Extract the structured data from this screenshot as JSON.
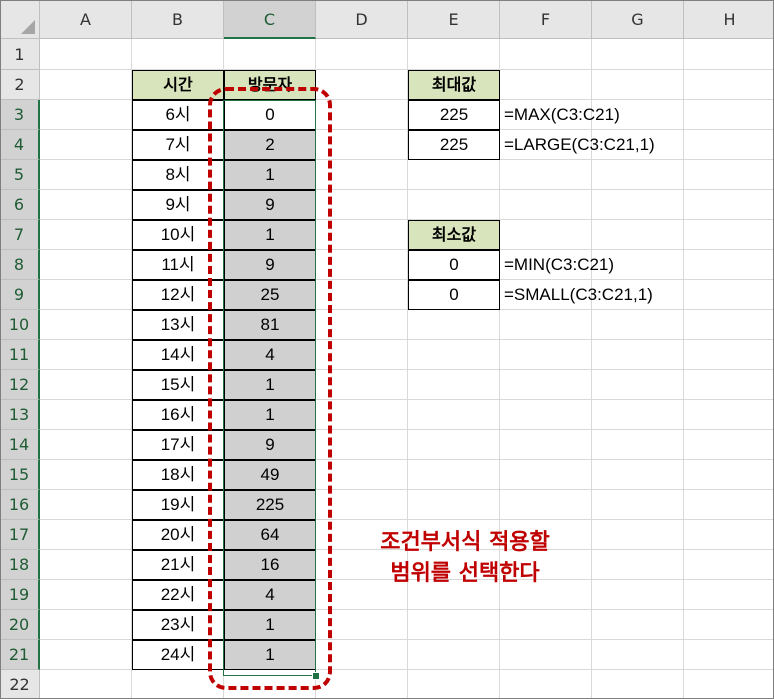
{
  "columns": [
    "A",
    "B",
    "C",
    "D",
    "E",
    "F",
    "G",
    "H"
  ],
  "selected_column": "C",
  "rows": [
    "1",
    "2",
    "3",
    "4",
    "5",
    "6",
    "7",
    "8",
    "9",
    "10",
    "11",
    "12",
    "13",
    "14",
    "15",
    "16",
    "17",
    "18",
    "19",
    "20",
    "21",
    "22"
  ],
  "table": {
    "header_time": "시간",
    "header_visitors": "방문자",
    "times": [
      "6시",
      "7시",
      "8시",
      "9시",
      "10시",
      "11시",
      "12시",
      "13시",
      "14시",
      "15시",
      "16시",
      "17시",
      "18시",
      "19시",
      "20시",
      "21시",
      "22시",
      "23시",
      "24시"
    ],
    "visitors": [
      "0",
      "2",
      "1",
      "9",
      "1",
      "9",
      "25",
      "81",
      "4",
      "1",
      "1",
      "9",
      "49",
      "225",
      "64",
      "16",
      "4",
      "1",
      "1"
    ]
  },
  "max_block": {
    "header": "최대값",
    "values": [
      "225",
      "225"
    ],
    "formulas": [
      "=MAX(C3:C21)",
      "=LARGE(C3:C21,1)"
    ]
  },
  "min_block": {
    "header": "최소값",
    "values": [
      "0",
      "0"
    ],
    "formulas": [
      "=MIN(C3:C21)",
      "=SMALL(C3:C21,1)"
    ]
  },
  "callout": {
    "line1": "조건부서식 적용할",
    "line2": "범위를 선택한다"
  },
  "colors": {
    "header_fill": "#d8e4bc",
    "selection_fill": "#d0d0d0",
    "selection_border": "#217346",
    "annotation": "#c00000"
  }
}
